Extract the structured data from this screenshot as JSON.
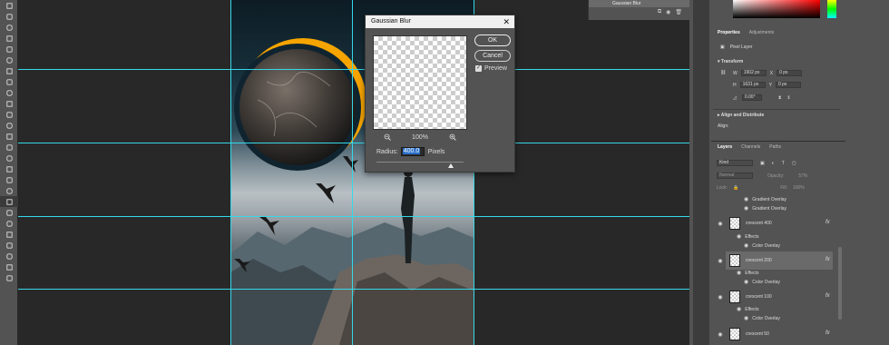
{
  "dialog": {
    "title": "Gaussian Blur",
    "ok": "OK",
    "cancel": "Cancel",
    "preview": "Preview",
    "zoom": "100%",
    "radius_label": "Radius:",
    "radius_value": "400.0",
    "units": "Pixels",
    "radius_slider_fraction": 0.85
  },
  "history": {
    "item": "Gaussian Blur"
  },
  "properties": {
    "tab1": "Properties",
    "tab2": "Adjustments",
    "type": "Pixel Layer",
    "transform": "Transform",
    "w_label": "W",
    "w": "1902 px",
    "x_label": "X",
    "x": "0 px",
    "h_label": "H",
    "h": "1631 px",
    "y_label": "Y",
    "y": "0 px",
    "angle": "0.00°",
    "align": "Align and Distribute",
    "align_label": "Align:"
  },
  "layers_panel": {
    "tab1": "Layers",
    "tab2": "Channels",
    "tab3": "Paths",
    "kind": "Kind",
    "blend": "Normal",
    "opacity": "Opacity:",
    "opacity_val": "57%",
    "lock": "Lock:",
    "fill": "Fill:",
    "fill_val": "100%"
  },
  "layers": [
    {
      "sub": "Gradient Overlay"
    },
    {
      "sub": "Gradient Overlay"
    },
    {
      "name": "crescent 400",
      "fx": "fx",
      "effects": "Effects",
      "effect": "Color Overlay"
    },
    {
      "name": "crescent 200",
      "fx": "fx",
      "effects": "Effects",
      "effect": "Color Overlay"
    },
    {
      "name": "crescent 100",
      "fx": "fx",
      "effects": "Effects",
      "effect": "Color Overlay"
    },
    {
      "name": "crescent 50",
      "fx": "fx"
    }
  ],
  "colors": {
    "guide": "#36d8e8",
    "crescent": "#f5a400",
    "selection": "#2a6fc9"
  }
}
